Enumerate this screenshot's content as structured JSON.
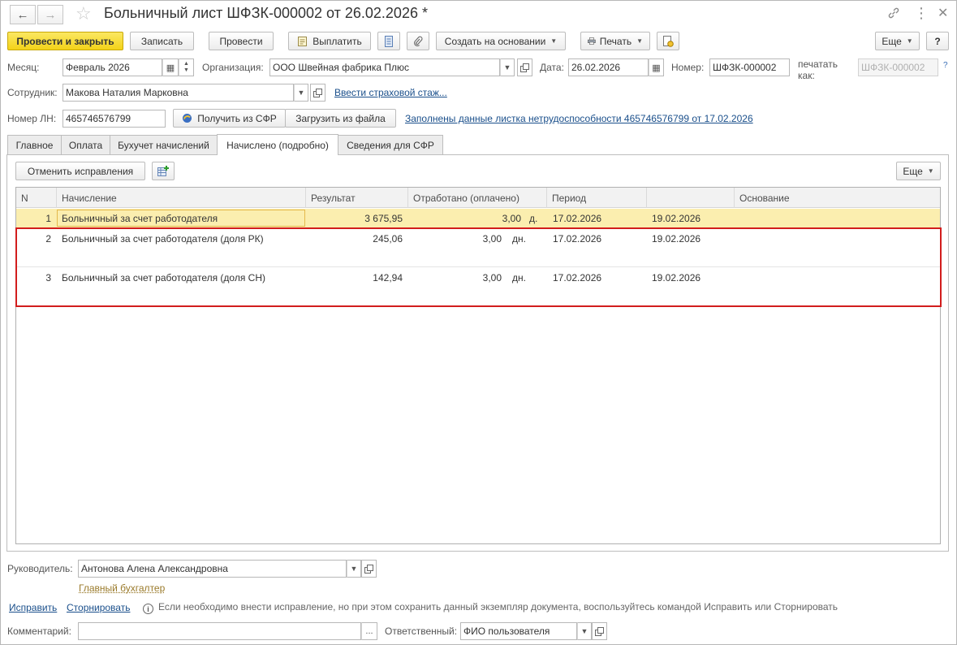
{
  "window": {
    "title": "Больничный лист ШФЗК-000002 от 26.02.2026 *"
  },
  "toolbar": {
    "post_and_close": "Провести и закрыть",
    "save": "Записать",
    "post": "Провести",
    "pay": "Выплатить",
    "create_based_on": "Создать на основании",
    "print": "Печать",
    "more": "Еще",
    "help": "?"
  },
  "header": {
    "month_label": "Месяц:",
    "month_value": "Февраль 2026",
    "org_label": "Организация:",
    "org_value": "ООО Швейная фабрика Плюс",
    "date_label": "Дата:",
    "date_value": "26.02.2026",
    "number_label": "Номер:",
    "number_value": "ШФЗК-000002",
    "print_as_label_1": "печатать",
    "print_as_label_2": "как:",
    "print_as_value": "ШФЗК-000002",
    "print_as_help": "?",
    "employee_label": "Сотрудник:",
    "employee_value": "Макова Наталия Марковна",
    "insurance_link": "Ввести страховой стаж...",
    "ln_label": "Номер ЛН:",
    "ln_value": "465746576799",
    "get_from_sfr": "Получить из СФР",
    "load_from_file": "Загрузить из файла",
    "filled_link": "Заполнены данные листка нетрудоспособности 465746576799 от 17.02.2026"
  },
  "tabs": [
    {
      "label": "Главное",
      "active": false
    },
    {
      "label": "Оплата",
      "active": false
    },
    {
      "label": "Бухучет начислений",
      "active": false
    },
    {
      "label": "Начислено (подробно)",
      "active": true
    },
    {
      "label": "Сведения для СФР",
      "active": false
    }
  ],
  "panel": {
    "cancel_corrections": "Отменить исправления",
    "more": "Еще"
  },
  "table": {
    "columns": [
      "N",
      "Начисление",
      "Результат",
      "Отработано (оплачено)",
      "Период",
      "",
      "Основание"
    ],
    "rows": [
      {
        "n": "1",
        "accrual": "Больничный за счет работодателя",
        "result": "3 675,95",
        "worked": "3,00",
        "unit": "д.",
        "period_from": "17.02.2026",
        "period_to": "19.02.2026",
        "basis": ""
      },
      {
        "n": "2",
        "accrual": "Больничный за счет работодателя (доля РК)",
        "result": "245,06",
        "worked": "3,00",
        "unit": "дн.",
        "period_from": "17.02.2026",
        "period_to": "19.02.2026",
        "basis": ""
      },
      {
        "n": "3",
        "accrual": "Больничный за счет работодателя (доля СН)",
        "result": "142,94",
        "worked": "3,00",
        "unit": "дн.",
        "period_from": "17.02.2026",
        "period_to": "19.02.2026",
        "basis": ""
      }
    ]
  },
  "footer": {
    "manager_label": "Руководитель:",
    "manager_value": "Антонова Алена Александровна",
    "chief_accountant_link": "Главный бухгалтер",
    "fix_link": "Исправить",
    "reverse_link": "Сторнировать",
    "info_text": "Если необходимо внести исправление, но при этом сохранить данный экземпляр документа, воспользуйтесь командой Исправить или Сторнировать",
    "comment_label": "Комментарий:",
    "comment_value": "",
    "comment_btn": "...",
    "responsible_label": "Ответственный:",
    "responsible_value": "ФИО пользователя"
  },
  "colors": {
    "primary_button": "#f3d319",
    "selected_row": "#fbeeaf",
    "highlight_box": "#d21d1d",
    "link": "#1a4f8b"
  }
}
